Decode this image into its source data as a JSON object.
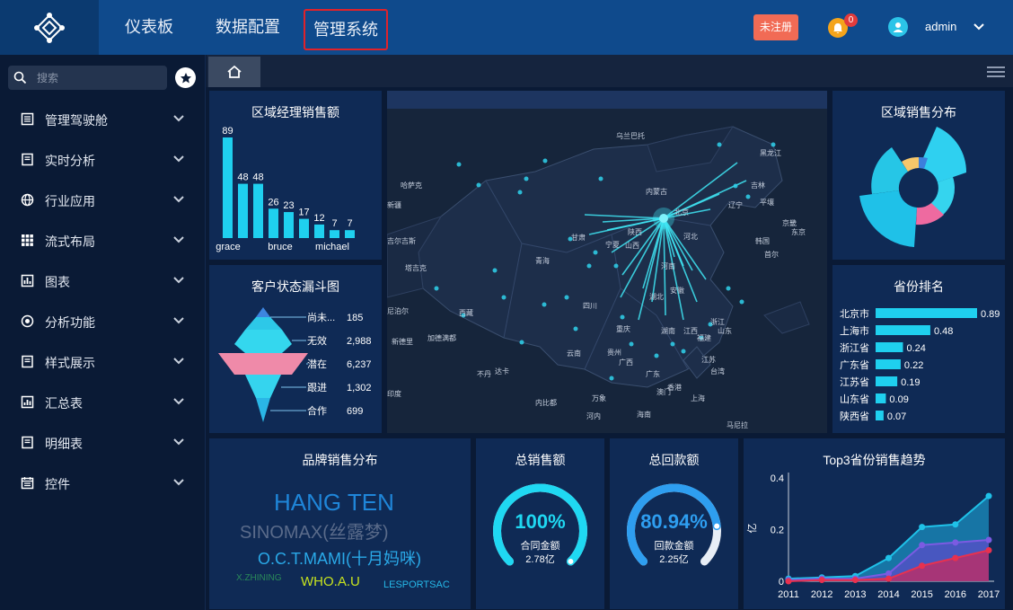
{
  "nav": {
    "items": [
      "仪表板",
      "数据配置",
      "管理系统"
    ],
    "unregistered": "未注册",
    "bell_count": "0",
    "user": "admin"
  },
  "sidebar": {
    "search_placeholder": "搜索",
    "items": [
      "管理驾驶舱",
      "实时分析",
      "行业应用",
      "流式布局",
      "图表",
      "分析功能",
      "样式展示",
      "汇总表",
      "明细表",
      "控件"
    ]
  },
  "panels": {
    "manager_sales": "区域经理销售额",
    "funnel": "客户状态漏斗图",
    "region_dist": "区域销售分布",
    "province_rank": "省份排名",
    "brand": "品牌销售分布",
    "total_sales": "总销售额",
    "total_payment": "总回款额",
    "trend": "Top3省份销售趋势"
  },
  "manager_chart": {
    "values": [
      89,
      48,
      48,
      26,
      23,
      17,
      12,
      7,
      7
    ],
    "labels": [
      "grace",
      "bruce",
      "michael"
    ]
  },
  "funnel": {
    "stages": [
      {
        "name": "尚未...",
        "value": "185"
      },
      {
        "name": "无效",
        "value": "2,988"
      },
      {
        "name": "潜在",
        "value": "6,237"
      },
      {
        "name": "跟进",
        "value": "1,302"
      },
      {
        "name": "合作",
        "value": "699"
      }
    ]
  },
  "rank": {
    "rows": [
      {
        "name": "北京市",
        "value": 0.89
      },
      {
        "name": "上海市",
        "value": 0.48
      },
      {
        "name": "浙江省",
        "value": 0.24
      },
      {
        "name": "广东省",
        "value": 0.22
      },
      {
        "name": "江苏省",
        "value": 0.19
      },
      {
        "name": "山东省",
        "value": 0.09
      },
      {
        "name": "陕西省",
        "value": 0.07
      }
    ]
  },
  "brands": [
    "HANG TEN",
    "SINOMAX(丝露梦)",
    "O.C.T.MAMI(十月妈咪)",
    "X.ZHINING",
    "WHO.A.U",
    "LESPORTSAC"
  ],
  "total_sales": {
    "percent": "100%",
    "label": "合同金额",
    "amount": "2.78亿",
    "fraction": 1.0
  },
  "total_payment": {
    "percent": "80.94%",
    "label": "回款金额",
    "amount": "2.25亿",
    "fraction": 0.8094
  },
  "map": {
    "labels": [
      "乌兰巴托",
      "黑龙江",
      "吉林",
      "辽宁",
      "内蒙古",
      "北京",
      "甘肃",
      "宁夏",
      "青海",
      "山西",
      "河北",
      "河南",
      "湖北",
      "安徽",
      "四川",
      "陕西",
      "重庆",
      "贵州",
      "湖南",
      "江西",
      "浙江",
      "福建",
      "云南",
      "广西",
      "广东",
      "台湾",
      "香港",
      "澳门",
      "海南",
      "西藏",
      "新疆",
      "尼泊尔",
      "加德满都",
      "达卡",
      "不丹",
      "内比都",
      "万象",
      "河内",
      "上海",
      "江苏",
      "山东",
      "平壤",
      "首尔",
      "京畿",
      "韩国",
      "东京",
      "马尼拉",
      "哈萨克",
      "吉尔吉斯",
      "塔吉克",
      "新德里",
      "印度"
    ]
  },
  "chart_data": [
    {
      "type": "bar",
      "title": "区域经理销售额",
      "categories": [
        "grace",
        "",
        "bruce",
        "",
        "",
        "michael",
        "",
        "",
        ""
      ],
      "values": [
        89,
        48,
        48,
        26,
        23,
        17,
        12,
        7,
        7
      ]
    },
    {
      "type": "bar",
      "title": "省份排名",
      "categories": [
        "北京市",
        "上海市",
        "浙江省",
        "广东省",
        "江苏省",
        "山东省",
        "陕西省"
      ],
      "values": [
        0.89,
        0.48,
        0.24,
        0.22,
        0.19,
        0.09,
        0.07
      ]
    },
    {
      "type": "area",
      "title": "Top3省份销售趋势",
      "ylabel": "亿",
      "x": [
        2011,
        2012,
        2013,
        2014,
        2015,
        2016,
        2017
      ],
      "ylim": [
        0,
        0.4
      ],
      "yticks": [
        "0.4",
        "0.2",
        "0"
      ],
      "series": [
        {
          "values": [
            0.01,
            0.015,
            0.02,
            0.09,
            0.21,
            0.22,
            0.33
          ]
        },
        {
          "values": [
            0.005,
            0.01,
            0.01,
            0.03,
            0.14,
            0.15,
            0.16
          ]
        },
        {
          "values": [
            0.0,
            0.005,
            0.005,
            0.01,
            0.06,
            0.09,
            0.12
          ]
        }
      ],
      "colors": [
        "#1fc1e8",
        "#7b5be2",
        "#e8314f"
      ]
    }
  ]
}
